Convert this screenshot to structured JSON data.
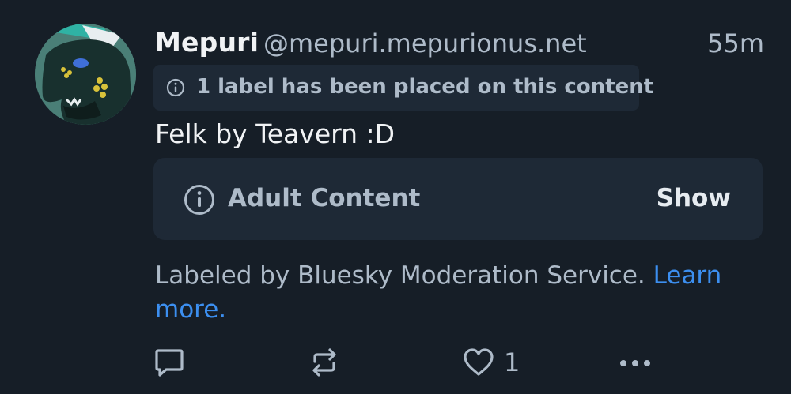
{
  "post": {
    "author": {
      "display_name": "Mepuri",
      "handle": "@mepuri.mepurionus.net"
    },
    "timestamp": "55m",
    "label_notice": {
      "icon": "info-circle-icon",
      "text": "1 label has been placed on this content"
    },
    "text": "Felk by Teavern :D",
    "content_warning": {
      "icon": "info-circle-icon",
      "label": "Adult Content",
      "show_label": "Show"
    },
    "labeled_by": {
      "text": "Labeled by Bluesky Moderation Service.",
      "link_text": "Learn more."
    },
    "actions": {
      "reply_icon": "reply-icon",
      "repost_icon": "repost-icon",
      "like_icon": "heart-icon",
      "like_count": "1",
      "more_icon": "more-dots-icon"
    }
  },
  "colors": {
    "background": "#161e27",
    "card": "#1e2936",
    "primary_text": "#f1f3f5",
    "secondary_text": "#aebbc9",
    "link": "#3c8ff0"
  }
}
